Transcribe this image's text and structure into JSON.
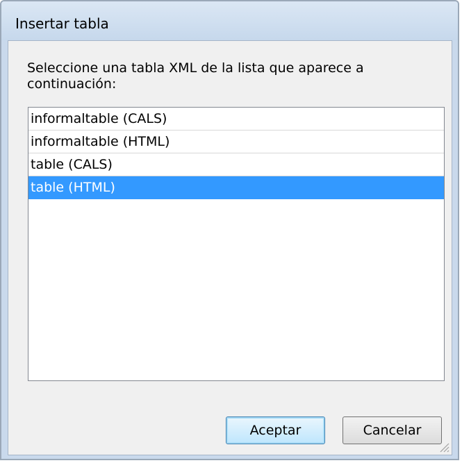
{
  "window": {
    "title": "Insertar tabla"
  },
  "dialog": {
    "prompt": "Seleccione una tabla XML de la lista que aparece a continuación:",
    "table_list": [
      {
        "label": "informaltable (CALS)",
        "selected": false
      },
      {
        "label": "informaltable (HTML)",
        "selected": false
      },
      {
        "label": "table (CALS)",
        "selected": false
      },
      {
        "label": "table (HTML)",
        "selected": true
      }
    ],
    "selection_color": "#3399ff",
    "buttons": {
      "ok_label": "Aceptar",
      "cancel_label": "Cancelar"
    }
  }
}
